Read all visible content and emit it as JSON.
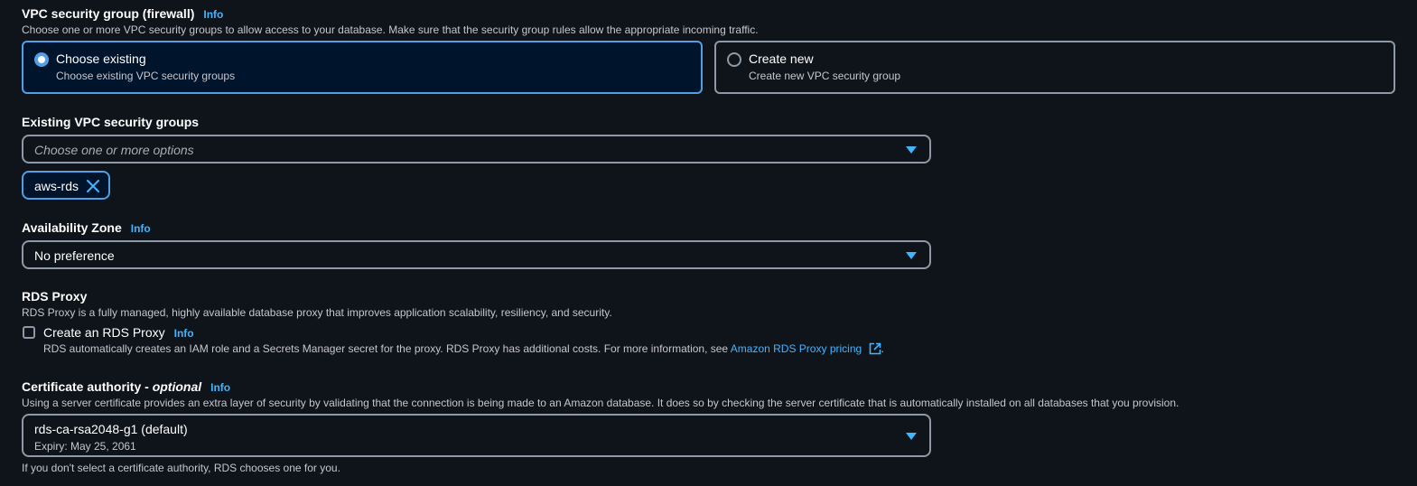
{
  "vpc": {
    "label": "VPC security group (firewall)",
    "info": "Info",
    "description": "Choose one or more VPC security groups to allow access to your database. Make sure that the security group rules allow the appropriate incoming traffic.",
    "options": [
      {
        "title": "Choose existing",
        "description": "Choose existing VPC security groups",
        "selected": true
      },
      {
        "title": "Create new",
        "description": "Create new VPC security group",
        "selected": false
      }
    ]
  },
  "existing_groups": {
    "label": "Existing VPC security groups",
    "placeholder": "Choose one or more options",
    "tokens": [
      "aws-rds"
    ]
  },
  "availability_zone": {
    "label": "Availability Zone",
    "info": "Info",
    "value": "No preference"
  },
  "rds_proxy": {
    "label": "RDS Proxy",
    "description": "RDS Proxy is a fully managed, highly available database proxy that improves application scalability, resiliency, and security.",
    "checkbox_label": "Create an RDS Proxy",
    "checked": false,
    "info": "Info",
    "checkbox_description": "RDS automatically creates an IAM role and a Secrets Manager secret for the proxy. RDS Proxy has additional costs. For more information, see ",
    "link_text": "Amazon RDS Proxy pricing",
    "after_link": "."
  },
  "certificate": {
    "label": "Certificate authority - ",
    "label_optional": "optional",
    "info": "Info",
    "description": "Using a server certificate provides an extra layer of security by validating that the connection is being made to an Amazon database. It does so by checking the server certificate that is automatically installed on all databases that you provision.",
    "value": "rds-ca-rsa2048-g1 (default)",
    "expiry": "Expiry: May 25, 2061",
    "hint": "If you don't select a certificate authority, RDS chooses one for you."
  },
  "colors": {
    "background": "#0f141a",
    "accent": "#539fe5",
    "link": "#42b4ff",
    "selected_card_bg": "#00142b",
    "border": "#8d99a8"
  }
}
